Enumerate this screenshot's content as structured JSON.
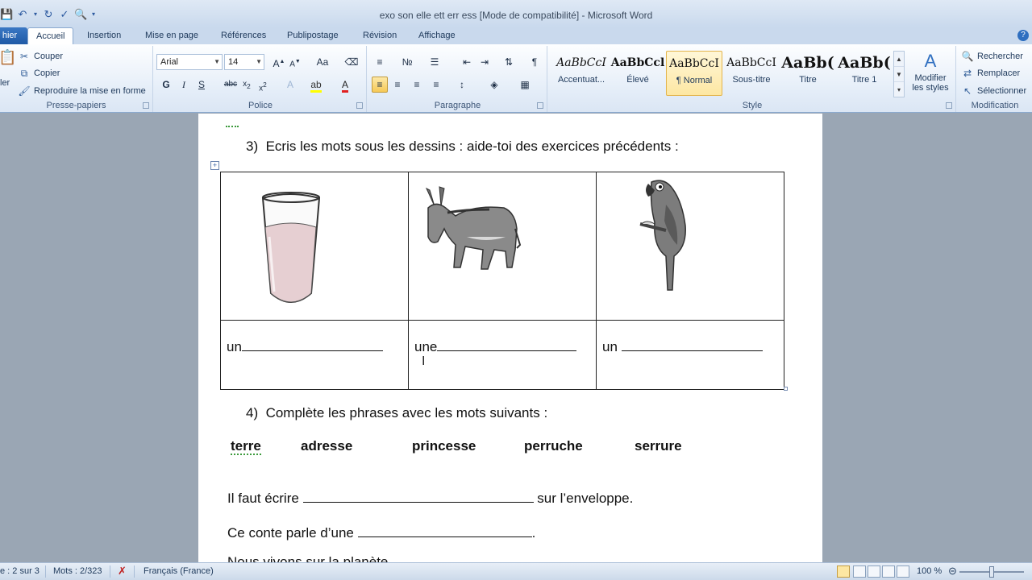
{
  "window": {
    "title": "exo son elle ett err ess [Mode de compatibilité] - Microsoft Word"
  },
  "tabs": {
    "file": "hier",
    "items": [
      "Accueil",
      "Insertion",
      "Mise en page",
      "Références",
      "Publipostage",
      "Révision",
      "Affichage"
    ]
  },
  "clipboard": {
    "cut": "Couper",
    "copy": "Copier",
    "format_painter": "Reproduire la mise en forme",
    "paste_partial": "ler",
    "label": "Presse-papiers"
  },
  "font": {
    "name": "Arial",
    "size": "14",
    "label": "Police",
    "bold": "G",
    "italic": "I",
    "underline": "S"
  },
  "paragraph": {
    "label": "Paragraphe"
  },
  "styles": {
    "label": "Style",
    "items": [
      {
        "sample": "AaBbCcI",
        "name": "Accentuat..."
      },
      {
        "sample": "AaBbCcl",
        "name": "Élevé"
      },
      {
        "sample": "AaBbCcI",
        "name": "¶ Normal"
      },
      {
        "sample": "AaBbCcI",
        "name": "Sous-titre"
      },
      {
        "sample": "AaBb(",
        "name": "Titre"
      },
      {
        "sample": "AaBb(",
        "name": "Titre 1"
      }
    ],
    "modify": "Modifier les styles"
  },
  "editing": {
    "find": "Rechercher",
    "replace": "Remplacer",
    "select": "Sélectionner",
    "label": "Modification"
  },
  "document": {
    "ex3_number": "3)",
    "ex3_text": "Ecris les mots sous les dessins : aide-toi des exercices précédents :",
    "table": {
      "images": [
        "glass-image",
        "donkey-image",
        "parrot-image"
      ],
      "answers": [
        "un",
        "une",
        "un"
      ]
    },
    "ex4_number": "4)",
    "ex4_text": "Complète les phrases avec les mots suivants :",
    "word_bank": [
      "terre",
      "adresse",
      "princesse",
      "perruche",
      "serrure"
    ],
    "sentence1_before": "Il faut écrire",
    "sentence1_after": "sur l’enveloppe.",
    "sentence2_before": "Ce conte parle d’une",
    "sentence2_after": ".",
    "sentence3_partial": "Nous vivons sur la planète"
  },
  "statusbar": {
    "page": "e : 2 sur 3",
    "words": "Mots : 2/323",
    "language": "Français (France)",
    "zoom": "100 %",
    "zoom_level": 1.0
  }
}
